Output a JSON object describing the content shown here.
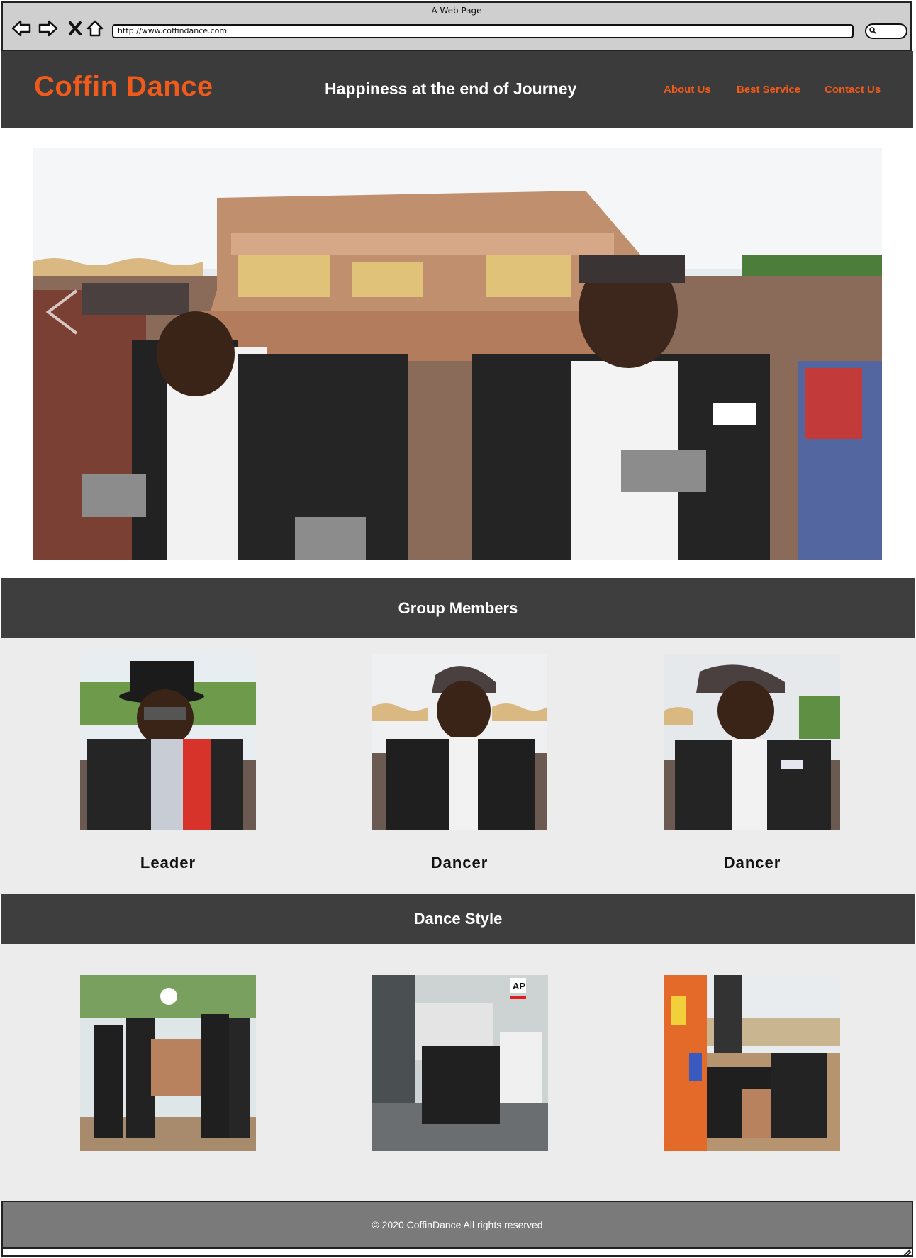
{
  "browser": {
    "window_title": "A Web Page",
    "url": "http://www.coffindance.com"
  },
  "header": {
    "logo": "Coffin Dance",
    "tagline": "Happiness at the end of Journey",
    "nav": [
      {
        "label": "About Us"
      },
      {
        "label": "Best Service"
      },
      {
        "label": "Contact Us"
      }
    ]
  },
  "members": {
    "title": "Group Members",
    "items": [
      {
        "name": "Leader"
      },
      {
        "name": "Dancer"
      },
      {
        "name": "Dancer"
      }
    ]
  },
  "dance_style": {
    "title": "Dance Style"
  },
  "footer": {
    "copyright": "© 2020 CoffinDance All rights reserved"
  },
  "colors": {
    "accent": "#f05a1a",
    "header_bg": "#3b3b3b",
    "section_bg": "#ececec",
    "footer_bg": "#7a7a7a"
  }
}
